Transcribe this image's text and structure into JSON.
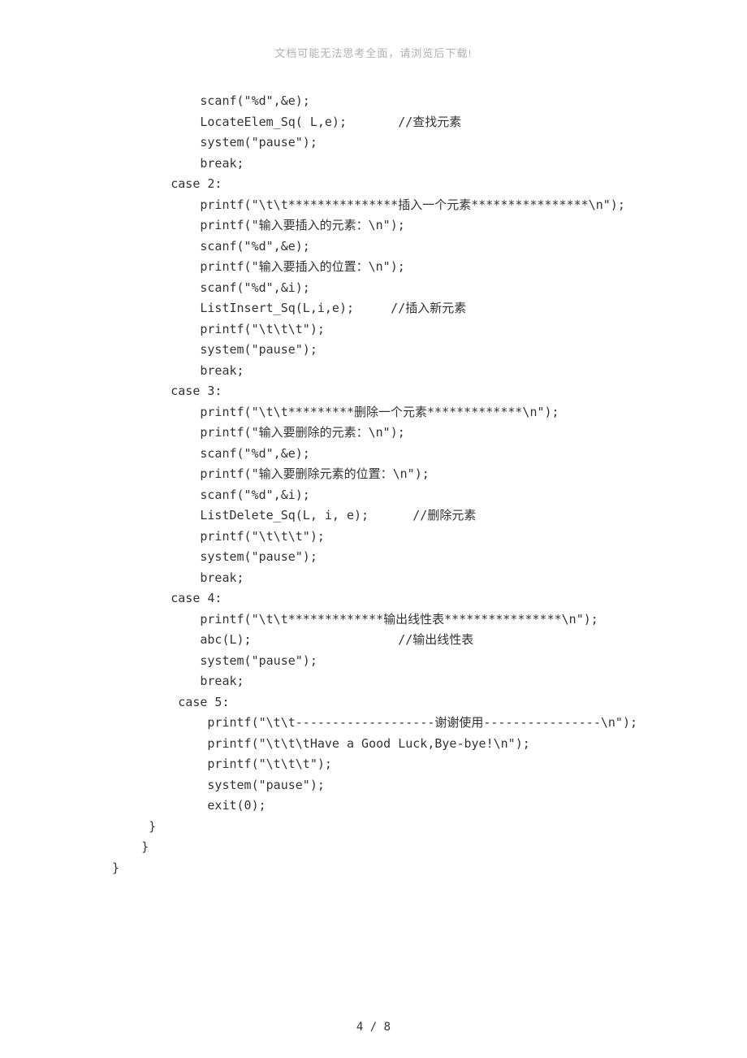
{
  "header_note": "文档可能无法思考全面，请浏览后下载!",
  "code_lines": [
    "            scanf(\"%d\",&e);",
    "            LocateElem_Sq( L,e);       //查找元素",
    "            system(\"pause\");",
    "            break;",
    "        case 2:",
    "            printf(\"\\t\\t***************插入一个元素****************\\n\");",
    "            printf(\"输入要插入的元素：\\n\");",
    "            scanf(\"%d\",&e);",
    "            printf(\"输入要插入的位置：\\n\");",
    "            scanf(\"%d\",&i);",
    "            ListInsert_Sq(L,i,e);     //插入新元素",
    "            printf(\"\\t\\t\\t\");",
    "            system(\"pause\");",
    "            break;",
    "        case 3:",
    "            printf(\"\\t\\t*********删除一个元素*************\\n\");",
    "            printf(\"输入要删除的元素：\\n\");",
    "            scanf(\"%d\",&e);",
    "            printf(\"输入要删除元素的位置：\\n\");",
    "            scanf(\"%d\",&i);",
    "            ListDelete_Sq(L, i, e);      //删除元素",
    "            printf(\"\\t\\t\\t\");",
    "            system(\"pause\");",
    "            break;",
    "        case 4:",
    "            printf(\"\\t\\t*************输出线性表****************\\n\");",
    "            abc(L);                    //输出线性表",
    "            system(\"pause\");",
    "            break;",
    "         case 5:",
    "             printf(\"\\t\\t-------------------谢谢使用----------------\\n\");",
    "             printf(\"\\t\\t\\tHave a Good Luck,Bye-bye!\\n\");",
    "             printf(\"\\t\\t\\t\");",
    "             system(\"pause\");",
    "             exit(0);",
    "     }",
    "    }",
    "}"
  ],
  "page_number": "4 / 8"
}
